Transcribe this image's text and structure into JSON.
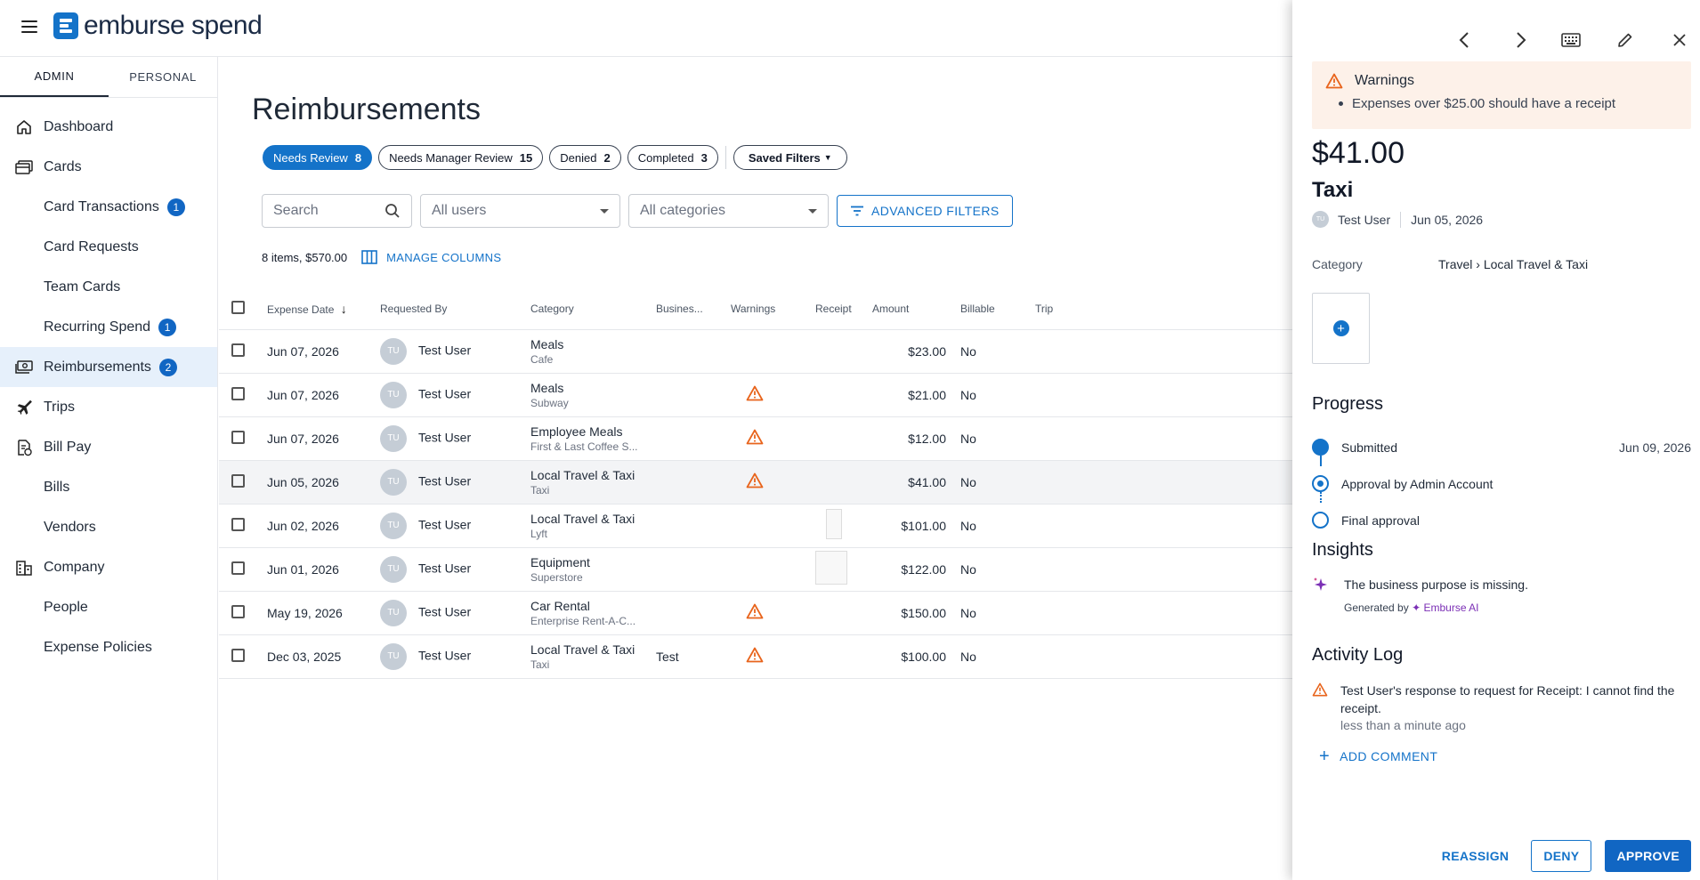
{
  "app": {
    "logo_text": "emburse spend"
  },
  "sidebar": {
    "tabs": [
      {
        "label": "ADMIN"
      },
      {
        "label": "PERSONAL"
      }
    ],
    "items": [
      {
        "label": "Dashboard",
        "icon": "home-icon"
      },
      {
        "label": "Cards",
        "icon": "cards-icon"
      },
      {
        "label": "Card Transactions",
        "badge": "1"
      },
      {
        "label": "Card Requests"
      },
      {
        "label": "Team Cards"
      },
      {
        "label": "Recurring Spend",
        "badge": "1"
      },
      {
        "label": "Reimbursements",
        "icon": "cash-icon",
        "badge": "2"
      },
      {
        "label": "Trips",
        "icon": "plane-icon"
      },
      {
        "label": "Bill Pay",
        "icon": "bill-icon"
      },
      {
        "label": "Bills"
      },
      {
        "label": "Vendors"
      },
      {
        "label": "Company",
        "icon": "building-icon"
      },
      {
        "label": "People"
      },
      {
        "label": "Expense Policies"
      }
    ]
  },
  "main": {
    "title": "Reimbursements",
    "chips": [
      {
        "label": "Needs Review",
        "count": "8"
      },
      {
        "label": "Needs Manager Review",
        "count": "15"
      },
      {
        "label": "Denied",
        "count": "2"
      },
      {
        "label": "Completed",
        "count": "3"
      }
    ],
    "saved_filters": "Saved Filters",
    "search_placeholder": "Search",
    "users_select": "All users",
    "categories_select": "All categories",
    "advanced_filters": "ADVANCED FILTERS",
    "summary": "8 items, $570.00",
    "manage_columns": "MANAGE COLUMNS",
    "columns": [
      "Expense Date",
      "Requested By",
      "Category",
      "Busines...",
      "Warnings",
      "Receipt",
      "Amount",
      "Billable",
      "Trip"
    ],
    "rows": [
      {
        "date": "Jun 07, 2026",
        "user": "Test User",
        "initials": "TU",
        "cat": "Meals",
        "sub": "Cafe",
        "business": "",
        "warning": false,
        "receipt": "",
        "amount": "$23.00",
        "billable": "No"
      },
      {
        "date": "Jun 07, 2026",
        "user": "Test User",
        "initials": "TU",
        "cat": "Meals",
        "sub": "Subway",
        "business": "",
        "warning": true,
        "receipt": "",
        "amount": "$21.00",
        "billable": "No"
      },
      {
        "date": "Jun 07, 2026",
        "user": "Test User",
        "initials": "TU",
        "cat": "Employee Meals",
        "sub": "First & Last Coffee S...",
        "business": "",
        "warning": true,
        "receipt": "",
        "amount": "$12.00",
        "billable": "No"
      },
      {
        "date": "Jun 05, 2026",
        "user": "Test User",
        "initials": "TU",
        "cat": "Local Travel & Taxi",
        "sub": "Taxi",
        "business": "",
        "warning": true,
        "receipt": "",
        "amount": "$41.00",
        "billable": "No",
        "selected": true
      },
      {
        "date": "Jun 02, 2026",
        "user": "Test User",
        "initials": "TU",
        "cat": "Local Travel & Taxi",
        "sub": "Lyft",
        "business": "",
        "warning": false,
        "receipt": "narrow",
        "amount": "$101.00",
        "billable": "No"
      },
      {
        "date": "Jun 01, 2026",
        "user": "Test User",
        "initials": "TU",
        "cat": "Equipment",
        "sub": "Superstore",
        "business": "",
        "warning": false,
        "receipt": "wide",
        "amount": "$122.00",
        "billable": "No"
      },
      {
        "date": "May 19, 2026",
        "user": "Test User",
        "initials": "TU",
        "cat": "Car Rental",
        "sub": "Enterprise Rent-A-C...",
        "business": "",
        "warning": true,
        "receipt": "",
        "amount": "$150.00",
        "billable": "No"
      },
      {
        "date": "Dec 03, 2025",
        "user": "Test User",
        "initials": "TU",
        "cat": "Local Travel & Taxi",
        "sub": "Taxi",
        "business": "Test",
        "warning": true,
        "receipt": "",
        "amount": "$100.00",
        "billable": "No"
      }
    ]
  },
  "panel": {
    "warnings_title": "Warnings",
    "warning_item": "Expenses over $25.00 should have a receipt",
    "amount": "$41.00",
    "title": "Taxi",
    "user": "Test User",
    "user_initials": "TU",
    "date": "Jun 05, 2026",
    "category_label": "Category",
    "category_value": "Travel › Local Travel & Taxi",
    "progress_title": "Progress",
    "steps": [
      {
        "label": "Submitted",
        "date": "Jun 09, 2026"
      },
      {
        "label": "Approval by Admin Account",
        "date": ""
      },
      {
        "label": "Final approval",
        "date": ""
      }
    ],
    "insights_title": "Insights",
    "insight_text": "The business purpose is missing.",
    "generated_by": "Generated by",
    "ai_name": "Emburse AI",
    "activity_title": "Activity Log",
    "log_text": "Test User's response to request for Receipt: I cannot find the receipt.",
    "log_time": "less than a minute ago",
    "add_comment": "ADD COMMENT",
    "reassign": "REASSIGN",
    "deny": "DENY",
    "approve": "APPROVE"
  },
  "colors": {
    "accent": "#1473c9",
    "warning": "#e8641c",
    "ai": "#7b2fb5"
  }
}
